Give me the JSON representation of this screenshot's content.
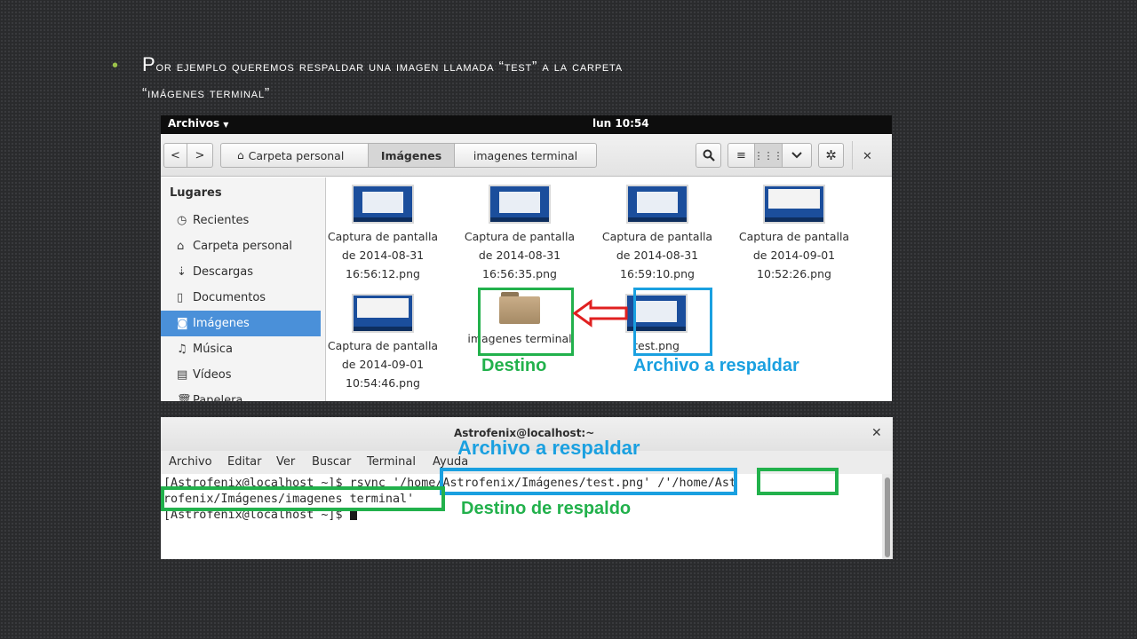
{
  "slide": {
    "bullet": "•",
    "heading_line1": "Por ejemplo queremos respaldar una imagen llamada “test” a  la carpeta",
    "heading_line2": "“imágenes terminal”"
  },
  "file_manager": {
    "topbar": {
      "activities": "Archivos",
      "clock": "lun 10:54"
    },
    "toolbar": {
      "back_icon": "chevron-left-icon",
      "forward_icon": "chevron-right-icon",
      "breadcrumbs": [
        "Carpeta personal",
        "Imágenes",
        "imagenes terminal"
      ],
      "active_breadcrumb": "Imágenes",
      "search_icon": "search-icon",
      "list_icon": "list-view-icon",
      "grid_icon": "grid-view-icon",
      "menu_icon": "chevron-down-icon",
      "gear_icon": "gear-icon",
      "close_icon": "close-icon"
    },
    "sidebar": {
      "title": "Lugares",
      "items": [
        {
          "label": "Recientes",
          "icon": "clock-icon"
        },
        {
          "label": "Carpeta personal",
          "icon": "home-icon"
        },
        {
          "label": "Descargas",
          "icon": "download-icon"
        },
        {
          "label": "Documentos",
          "icon": "document-icon"
        },
        {
          "label": "Imágenes",
          "icon": "camera-icon",
          "selected": true
        },
        {
          "label": "Música",
          "icon": "music-icon"
        },
        {
          "label": "Vídeos",
          "icon": "film-icon"
        },
        {
          "label": "Papelera",
          "icon": "trash-icon"
        }
      ]
    },
    "files": [
      {
        "name_lines": [
          "Captura de pantalla",
          "de 2014-08-31",
          "16:56:12.png"
        ]
      },
      {
        "name_lines": [
          "Captura de pantalla",
          "de 2014-08-31",
          "16:56:35.png"
        ]
      },
      {
        "name_lines": [
          "Captura de pantalla",
          "de 2014-08-31",
          "16:59:10.png"
        ]
      },
      {
        "name_lines": [
          "Captura de pantalla",
          "de 2014-09-01",
          "10:52:26.png"
        ]
      },
      {
        "name_lines": [
          "Captura de pantalla",
          "de 2014-09-01",
          "10:54:46.png"
        ]
      },
      {
        "name_lines": [
          "imagenes terminal"
        ],
        "type": "folder"
      },
      {
        "name_lines": [
          "test.png"
        ]
      }
    ],
    "annotations": {
      "destino": "Destino",
      "archivo": "Archivo a respaldar"
    }
  },
  "terminal": {
    "title": "Astrofenix@localhost:~",
    "menu": [
      "Archivo",
      "Editar",
      "Ver",
      "Buscar",
      "Terminal",
      "Ayuda"
    ],
    "lines": [
      "[Astrofenix@localhost ~]$ rsync '/home/Astrofenix/Imágenes/test.png' /'/home/Ast",
      "rofenix/Imágenes/imagenes terminal'",
      "[Astrofenix@localhost ~]$ "
    ],
    "annotations": {
      "archivo": "Archivo a respaldar",
      "destino": "Destino de respaldo"
    }
  },
  "colors": {
    "green": "#22b14c",
    "blue": "#1aa0e0",
    "red_arrow": "#e02020",
    "selection": "#4a90d9"
  }
}
